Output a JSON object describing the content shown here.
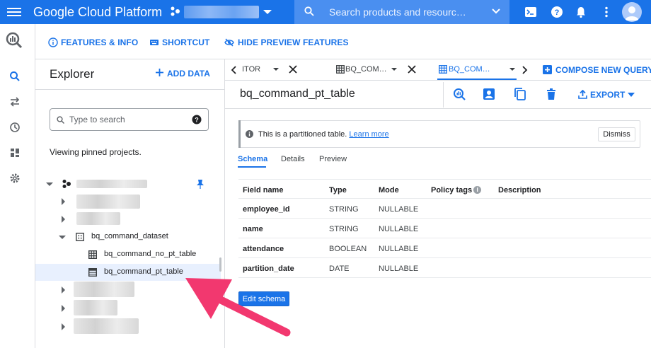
{
  "topbar": {
    "brand": "Google Cloud Platform",
    "search_placeholder": "Search products and resourc…",
    "icons": [
      "menu-icon",
      "cloud-shell-icon",
      "help-icon",
      "notifications-icon",
      "more-vert-icon",
      "account-avatar"
    ],
    "bg_color": "#1a73e8"
  },
  "featurebar": {
    "features_info": "FEATURES & INFO",
    "shortcut": "SHORTCUT",
    "hide_preview": "HIDE PREVIEW FEATURES"
  },
  "explorer": {
    "title": "Explorer",
    "add_data": "ADD DATA",
    "search_placeholder": "Type to search",
    "viewing": "Viewing pinned projects.",
    "dataset": "bq_command_dataset",
    "tables": [
      "bq_command_no_pt_table",
      "bq_command_pt_table"
    ]
  },
  "tabs": {
    "items": [
      {
        "label": "ITOR"
      },
      {
        "label": "BQ_COM…"
      },
      {
        "label": "BQ_COM…"
      }
    ],
    "compose": "COMPOSE NEW QUERY"
  },
  "table": {
    "title": "bq_command_pt_table",
    "export": "EXPORT"
  },
  "banner": {
    "text": "This is a partitioned table.",
    "link": "Learn more",
    "dismiss": "Dismiss"
  },
  "subtabs": [
    "Schema",
    "Details",
    "Preview"
  ],
  "schema": {
    "headers": {
      "field": "Field name",
      "type": "Type",
      "mode": "Mode",
      "policy": "Policy tags",
      "desc": "Description"
    },
    "rows": [
      {
        "name": "employee_id",
        "type": "STRING",
        "mode": "NULLABLE"
      },
      {
        "name": "name",
        "type": "STRING",
        "mode": "NULLABLE"
      },
      {
        "name": "attendance",
        "type": "BOOLEAN",
        "mode": "NULLABLE"
      },
      {
        "name": "partition_date",
        "type": "DATE",
        "mode": "NULLABLE"
      }
    ],
    "edit_button": "Edit schema"
  },
  "colors": {
    "accent": "#1a73e8",
    "arrow": "#f2386f"
  }
}
